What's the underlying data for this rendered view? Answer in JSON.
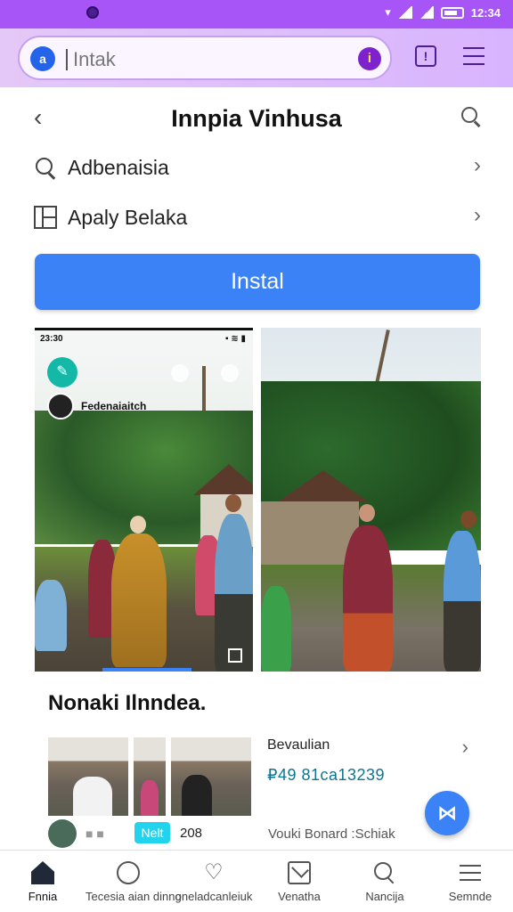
{
  "status_bar": {
    "time": "12:34"
  },
  "browser": {
    "url_text": "Intak",
    "logo_glyph": "a",
    "badge_glyph": "i",
    "message_glyph": "!"
  },
  "page": {
    "title": "Innpia Vinhusa",
    "back_glyph": "‹",
    "rows": [
      {
        "label": "Adbenaisia",
        "icon": "search-icon"
      },
      {
        "label": "Apaly Belaka",
        "icon": "grid-icon"
      }
    ],
    "row_chevron": "›",
    "install_label": "Instal"
  },
  "screenshot1": {
    "status_time": "23:30",
    "status_right": "▪ ≋ ▮",
    "profile_name": "Fedenaiaitch",
    "app_icon_glyph": "✎"
  },
  "section": {
    "title": "Nonaki Ilnndea.",
    "info_title": "Bevaulian",
    "info_number": "₽49 81ca13239",
    "chevron": "›",
    "fab_glyph": "⋈",
    "meta_blur": "■ ■",
    "meta_badge": "Nelt",
    "meta_count": "208",
    "meta_link": "Vouki Bonard :Schiak"
  },
  "bottom_nav": [
    {
      "label": "Fnnia",
      "icon": "home-icon"
    },
    {
      "label": "Tecesia aian dinng",
      "icon": "circle-icon"
    },
    {
      "label": "oneladcanleiuk",
      "icon": "heart-icon"
    },
    {
      "label": "Venatha",
      "icon": "mail-icon"
    },
    {
      "label": "Nancija",
      "icon": "search-icon"
    },
    {
      "label": "Semnde",
      "icon": "menu-icon"
    }
  ],
  "colors": {
    "status_bar": "#a855f7",
    "accent_blue": "#3b82f6",
    "browser_bar": "#d8b4fe"
  }
}
